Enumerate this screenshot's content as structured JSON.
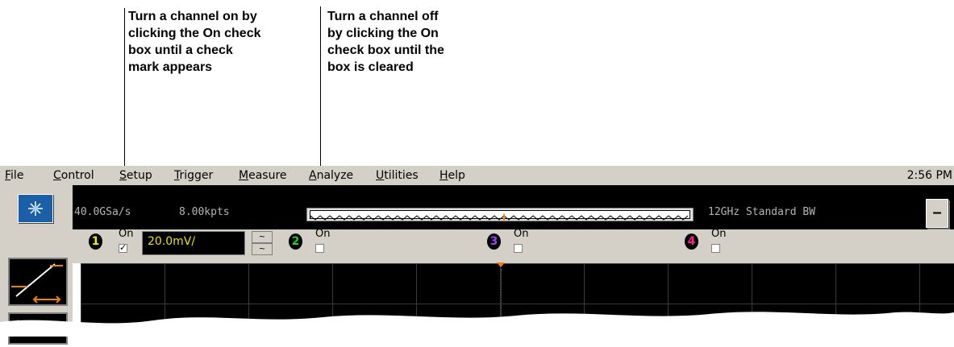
{
  "callouts": {
    "left": "Turn a channel on by\nclicking the On check\nbox until a check\nmark appears",
    "right": "Turn a channel off\nby clicking the On\ncheck box until the\nbox is cleared"
  },
  "menu": {
    "items": [
      {
        "pre": "",
        "ul": "F",
        "post": "ile"
      },
      {
        "pre": "",
        "ul": "C",
        "post": "ontrol"
      },
      {
        "pre": "",
        "ul": "S",
        "post": "etup"
      },
      {
        "pre": "",
        "ul": "T",
        "post": "rigger"
      },
      {
        "pre": "",
        "ul": "M",
        "post": "easure"
      },
      {
        "pre": "",
        "ul": "A",
        "post": "nalyze"
      },
      {
        "pre": "",
        "ul": "U",
        "post": "tilities"
      },
      {
        "pre": "",
        "ul": "H",
        "post": "elp"
      }
    ],
    "clock": "2:56 PM"
  },
  "status": {
    "sample_rate": "40.0GSa/s",
    "memory_depth": "8.00kpts",
    "bandwidth": "12GHz Standard BW",
    "minimize_label": "–"
  },
  "channels": [
    {
      "number": "1",
      "color": "#f0f000",
      "on_label": "On",
      "checked": true
    },
    {
      "number": "2",
      "color": "#20d020",
      "on_label": "On",
      "checked": false
    },
    {
      "number": "3",
      "color": "#a040ff",
      "on_label": "On",
      "checked": false
    },
    {
      "number": "4",
      "color": "#ff2090",
      "on_label": "On",
      "checked": false
    }
  ],
  "channel1_scale": "20.0mV/",
  "spin_glyph": "~",
  "check_glyph": "✓"
}
